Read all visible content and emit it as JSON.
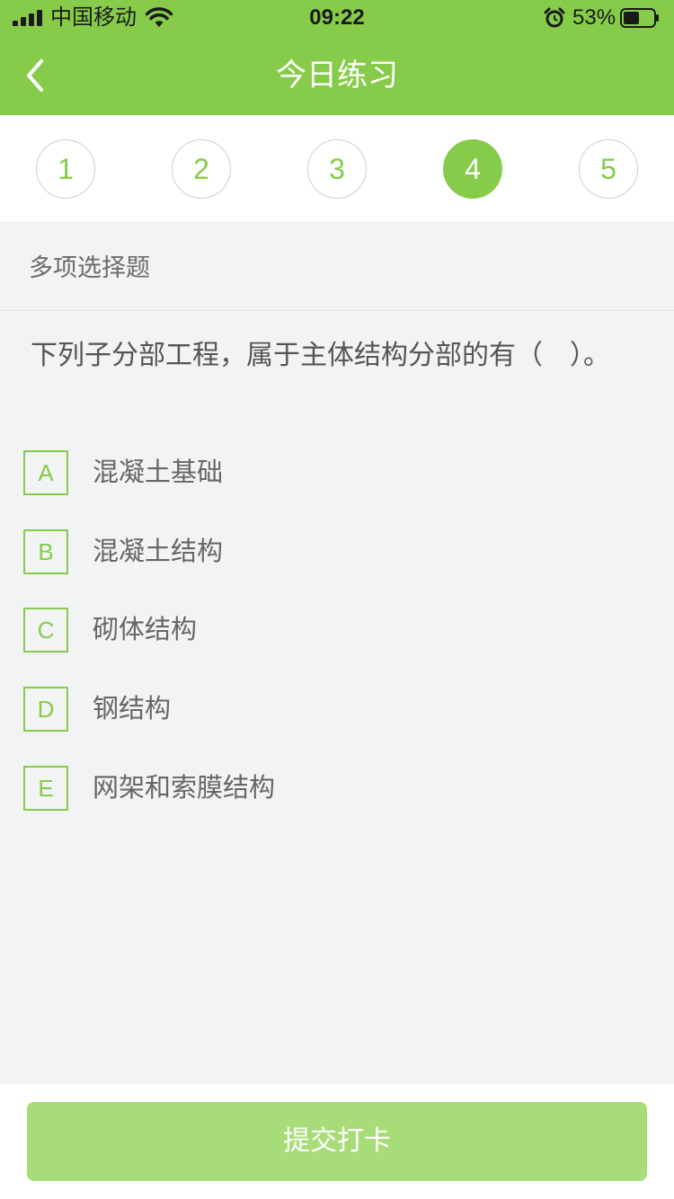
{
  "status_bar": {
    "carrier": "中国移动",
    "time": "09:22",
    "battery": "53%",
    "battery_level": 0.53,
    "icons": [
      "signal-icon",
      "wifi-icon",
      "alarm-icon",
      "battery-icon"
    ]
  },
  "nav": {
    "title": "今日练习",
    "back_icon": "chevron-left-icon"
  },
  "steps": {
    "items": [
      "1",
      "2",
      "3",
      "4",
      "5"
    ],
    "active": "4"
  },
  "question": {
    "type": "多项选择题",
    "text": "下列子分部工程，属于主体结构分部的有（　）。",
    "options": [
      {
        "letter": "A",
        "text": "混凝土基础"
      },
      {
        "letter": "B",
        "text": "混凝土结构"
      },
      {
        "letter": "C",
        "text": "砌体结构"
      },
      {
        "letter": "D",
        "text": "钢结构"
      },
      {
        "letter": "E",
        "text": "网架和索膜结构"
      }
    ]
  },
  "footer": {
    "submit_label": "提交打卡"
  },
  "colors": {
    "accent": "#86cc4a",
    "button_disabled": "#a8dc78",
    "background": "#f2f3f5"
  }
}
